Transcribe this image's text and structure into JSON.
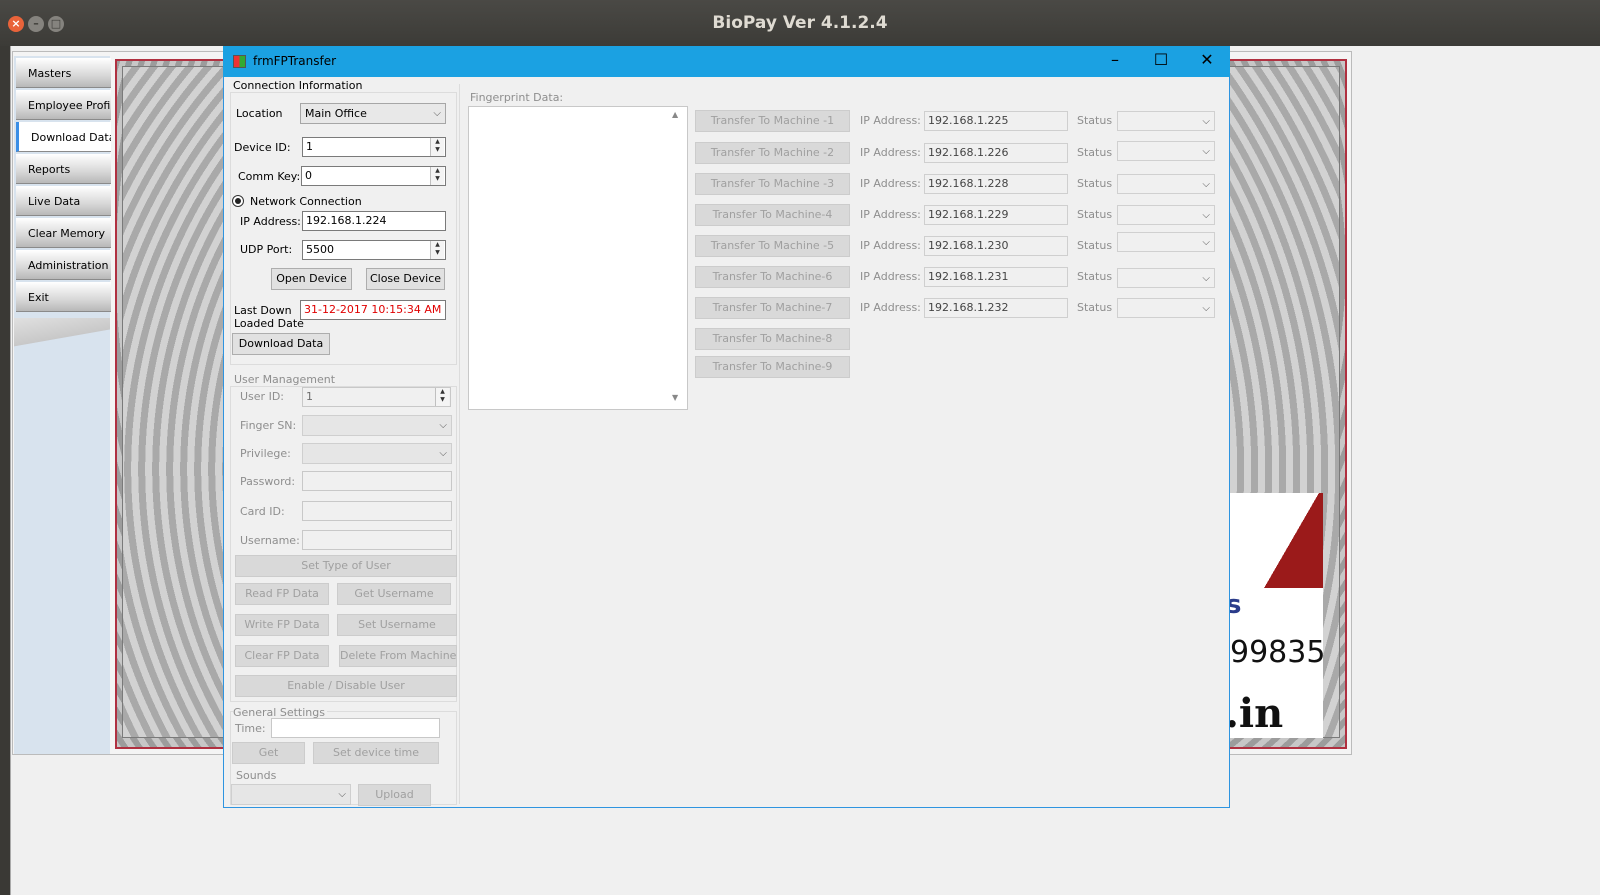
{
  "window": {
    "title": "BioPay Ver 4.1.2.4"
  },
  "menu": {
    "items": [
      {
        "label": "Masters"
      },
      {
        "label": "Employee Profile"
      },
      {
        "label": "Download Data"
      },
      {
        "label": "Reports"
      },
      {
        "label": "Live Data"
      },
      {
        "label": "Clear Memory"
      },
      {
        "label": "Administration"
      },
      {
        "label": "Exit"
      }
    ]
  },
  "background_logo": {
    "letter": "s",
    "phone_fragment": "99835",
    "domain_fragment": ".in"
  },
  "dialog": {
    "title": "frmFPTransfer",
    "connection": {
      "group_title": "Connection Information",
      "location_label": "Location",
      "location_value": "Main Office",
      "device_id_label": "Device ID:",
      "device_id_value": "1",
      "comm_key_label": "Comm Key:",
      "comm_key_value": "0",
      "network_label": "Network Connection",
      "ip_label": "IP Address:",
      "ip_value": "192.168.1.224",
      "udp_label": "UDP Port:",
      "udp_value": "5500",
      "open_button": "Open Device",
      "close_button": "Close Device",
      "last_download_label_1": "Last Down",
      "last_download_label_2": "Loaded Date",
      "last_download_value": "31-12-2017 10:15:34 AM",
      "download_button": "Download Data"
    },
    "user_management": {
      "group_title": "User Management",
      "user_id_label": "User ID:",
      "user_id_value": "1",
      "finger_sn_label": "Finger SN:",
      "privilege_label": "Privilege:",
      "password_label": "Password:",
      "card_id_label": "Card ID:",
      "username_label": "Username:",
      "set_type_button": "Set Type of User",
      "read_fp_button": "Read FP Data",
      "get_username_button": "Get Username",
      "write_fp_button": "Write FP Data",
      "set_username_button": "Set Username",
      "clear_fp_button": "Clear FP Data",
      "delete_button": "Delete From Machine",
      "enable_button": "Enable / Disable User"
    },
    "general": {
      "group_title": "General Settings",
      "time_label": "Time:",
      "get_button": "Get",
      "set_time_button": "Set device time",
      "sounds_label": "Sounds",
      "upload_button": "Upload"
    },
    "fingerprint_label": "Fingerprint Data:",
    "ip_label": "IP Address:",
    "status_label": "Status",
    "machines": [
      {
        "button": "Transfer To Machine -1",
        "ip": "192.168.1.225"
      },
      {
        "button": "Transfer To Machine -2",
        "ip": "192.168.1.226"
      },
      {
        "button": "Transfer To Machine -3",
        "ip": "192.168.1.228"
      },
      {
        "button": "Transfer To Machine-4",
        "ip": "192.168.1.229"
      },
      {
        "button": "Transfer To Machine -5",
        "ip": "192.168.1.230"
      },
      {
        "button": "Transfer To Machine-6",
        "ip": "192.168.1.231"
      },
      {
        "button": "Transfer To Machine-7",
        "ip": "192.168.1.232"
      },
      {
        "button": "Transfer To Machine-8"
      },
      {
        "button": "Transfer To Machine-9"
      }
    ]
  }
}
